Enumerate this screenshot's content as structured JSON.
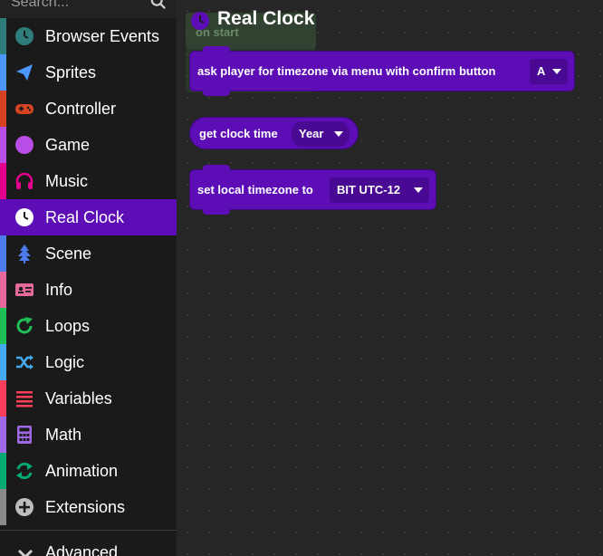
{
  "search": {
    "placeholder": "Search..."
  },
  "categories": [
    {
      "label": "Browser Events",
      "color": "#2e7d7b",
      "icon": "clock-icon"
    },
    {
      "label": "Sprites",
      "color": "#4c97ff",
      "icon": "paper-plane-icon"
    },
    {
      "label": "Controller",
      "color": "#d54322",
      "icon": "gamepad-icon"
    },
    {
      "label": "Game",
      "color": "#b84ee5",
      "icon": "circle-icon"
    },
    {
      "label": "Music",
      "color": "#e3008c",
      "icon": "headphones-icon"
    },
    {
      "label": "Real Clock",
      "color": "#5c0db5",
      "icon": "clock-icon",
      "selected": true
    },
    {
      "label": "Scene",
      "color": "#4b7bec",
      "icon": "tree-icon"
    },
    {
      "label": "Info",
      "color": "#e56a9b",
      "icon": "id-card-icon"
    },
    {
      "label": "Loops",
      "color": "#20bf55",
      "icon": "refresh-icon"
    },
    {
      "label": "Logic",
      "color": "#45aaf2",
      "icon": "shuffle-icon"
    },
    {
      "label": "Variables",
      "color": "#ff3f5a",
      "icon": "list-icon"
    },
    {
      "label": "Math",
      "color": "#9f69e6",
      "icon": "calculator-icon"
    },
    {
      "label": "Animation",
      "color": "#03aa74",
      "icon": "sync-icon"
    },
    {
      "label": "Extensions",
      "color": "#8a8a8a",
      "icon": "plus-circle-icon"
    }
  ],
  "advanced": {
    "label": "Advanced"
  },
  "flyout": {
    "title": "Real Clock",
    "ghost_label": "on start",
    "blocks": [
      {
        "text": "ask player for timezone via menu with confirm button",
        "dropdown": "A"
      },
      {
        "text": "get clock time",
        "dropdown": "Year"
      },
      {
        "text": "set local timezone to",
        "dropdown": "BIT UTC-12"
      }
    ]
  },
  "colors": {
    "block": "#5c0db5",
    "selected_bg": "#5c0db5",
    "sidebar_bg": "#1a1a1a",
    "workspace_bg": "#262626"
  }
}
